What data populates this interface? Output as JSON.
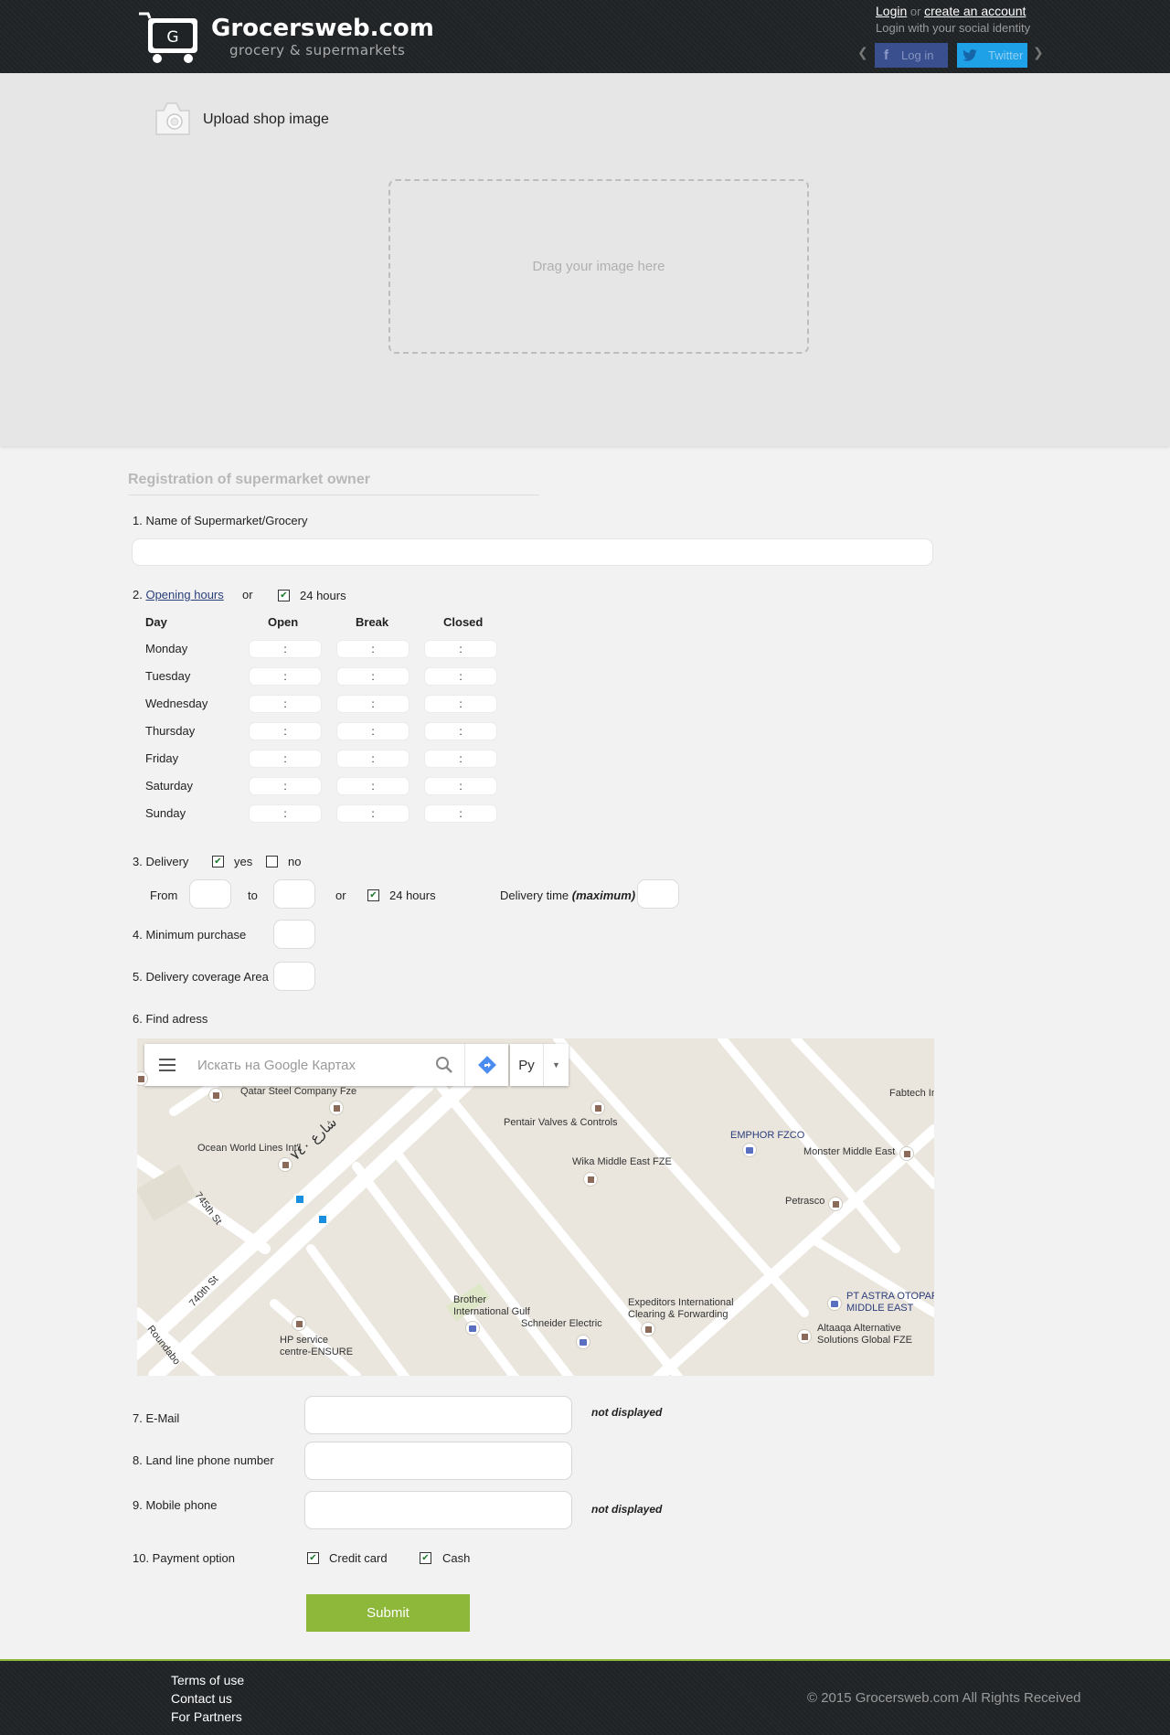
{
  "header": {
    "brand": "Grocersweb.com",
    "tagline": "grocery & supermarkets",
    "logo_letter": "G",
    "login_label": "Login",
    "or_label": "or",
    "create_account_label": "create an account",
    "social_text": "Login with your social identity",
    "facebook_label": "Log in",
    "twitter_label": "Twitter"
  },
  "upload": {
    "label": "Upload shop image",
    "dropzone_text": "Drag your image here"
  },
  "form": {
    "title": "Registration of supermarket owner",
    "q1_label": "1. Name of Supermarket/Grocery",
    "q2_prefix": "2.",
    "q2_link": "Opening hours",
    "q2_or": "or",
    "q2_24h": "24 hours",
    "hours_headers": {
      "day": "Day",
      "open": "Open",
      "break": "Break",
      "closed": "Closed"
    },
    "days": [
      "Monday",
      "Tuesday",
      "Wednesday",
      "Thursday",
      "Friday",
      "Saturday",
      "Sunday"
    ],
    "time_placeholder": ":",
    "q3_label": "3. Delivery",
    "q3_yes": "yes",
    "q3_no": "no",
    "from_label": "From",
    "to_label": "to",
    "or_label": "or",
    "delivery_24h": "24 hours",
    "delivery_time_label": "Delivery time",
    "delivery_time_qualifier": "(maximum)",
    "q4_label": "4. Minimum purchase",
    "q5_label": "5. Delivery  coverage Area",
    "q6_label": "6. Find adress",
    "q7_label": "7. E-Mail",
    "q8_label": "8. Land line phone number",
    "q9_label": "9. Mobile phone",
    "not_displayed": "not displayed",
    "q10_label": "10. Payment option",
    "pay_credit": "Credit card",
    "pay_cash": "Cash",
    "submit_label": "Submit"
  },
  "map": {
    "search_placeholder": "Искать на Google Картах",
    "language": "Ру",
    "labels": {
      "qatar_steel": "Qatar Steel Company Fze",
      "ocean_world": "Ocean World Lines Int'l",
      "pentair": "Pentair Valves & Controls",
      "emphor": "EMPHOR FZCO",
      "fabtech": "Fabtech In",
      "monster": "Monster Middle East",
      "wika": "Wika Middle East FZE",
      "petrasco": "Petrasco",
      "st745": "745th St",
      "st740": "740th St",
      "arabic": "شارع ٧٤٠",
      "roundabout": "Roundabo",
      "brother1": "Brother",
      "brother2": "International Gulf",
      "schneider": "Schneider Electric",
      "expeditors1": "Expeditors International",
      "expeditors2": "Clearing & Forwarding",
      "astra1": "PT ASTRA OTOPART",
      "astra2": "MIDDLE EAST",
      "altaaqa1": "Altaaqa Alternative",
      "altaaqa2": "Solutions Global FZE",
      "hp1": "HP service",
      "hp2": "centre-ENSURE"
    }
  },
  "footer": {
    "links": [
      "Terms of use",
      "Contact us",
      "For Partners"
    ],
    "copyright": "© 2015 Grocersweb.com All Rights Received"
  },
  "colors": {
    "header_bg": "#1f2326",
    "accent_green": "#8db83a",
    "facebook": "#3a4f8e",
    "twitter": "#1fa1e8",
    "link_blue": "#2a3e7a"
  }
}
